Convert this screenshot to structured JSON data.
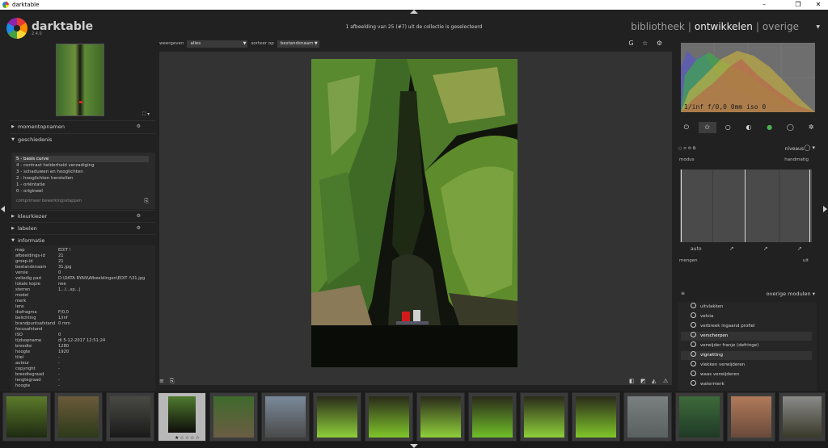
{
  "window": {
    "title": "darktable",
    "minimize": "–",
    "maximize": "❐",
    "close": "✕"
  },
  "header": {
    "logo_name": "darktable",
    "logo_version": "2.4.0",
    "collection_info": "1 afbeelding van 25 (#7) uit de collectie is geselecteerd",
    "views": [
      {
        "label": "bibliotheek"
      },
      {
        "label": "ontwikkelen"
      },
      {
        "label": "overige"
      }
    ]
  },
  "center": {
    "show_label": "weergeven",
    "show_value": "alles",
    "sort_label": "sorteer op",
    "sort_value": "bestandsnaam",
    "icons": "G ☆ ⚙"
  },
  "left": {
    "zoom": "⛶ ▾",
    "sections": {
      "snapshots": "momentopnamen",
      "history": "geschiedenis",
      "colorpicker": "kleurkiezer",
      "tags": "labelen",
      "info": "informatie"
    },
    "history": [
      "5 - basis curve",
      "4 - contrast helderheid verzadiging",
      "3 - schaduwen en hooglichten",
      "2 - hooglichten herstellen",
      "1 - oriëntatie",
      "0 - origineel"
    ],
    "compress": "comprimeer bewerkingsstappen",
    "info": [
      {
        "k": "map",
        "v": "EDIT !"
      },
      {
        "k": "afbeeldings-id",
        "v": "21"
      },
      {
        "k": "groep-id",
        "v": "21"
      },
      {
        "k": "bestandsnaam",
        "v": "31.jpg"
      },
      {
        "k": "versie",
        "v": "0"
      },
      {
        "k": "volledig pad",
        "v": "D:\\DATA RYAN\\Afbeeldingen\\EDIT !\\31.jpg"
      },
      {
        "k": "lokale kopie",
        "v": "nee"
      },
      {
        "k": "sterren",
        "v": "1...l...sp...j"
      },
      {
        "k": "model",
        "v": ""
      },
      {
        "k": "merk",
        "v": ""
      },
      {
        "k": "lens",
        "v": ""
      },
      {
        "k": "diafragma",
        "v": "F/0,0"
      },
      {
        "k": "belichting",
        "v": "1/inf"
      },
      {
        "k": "brandpuntsafstand",
        "v": "0 mm"
      },
      {
        "k": "focusafstand",
        "v": ""
      },
      {
        "k": "ISO",
        "v": "0"
      },
      {
        "k": "tijdsopname",
        "v": "di 5-12-2017 12:51:24"
      },
      {
        "k": "breedte",
        "v": "1280"
      },
      {
        "k": "hoogte",
        "v": "1920"
      },
      {
        "k": "titel",
        "v": "-"
      },
      {
        "k": "auteur",
        "v": "-"
      },
      {
        "k": "copyright",
        "v": "-"
      },
      {
        "k": "breedtegraad",
        "v": "-"
      },
      {
        "k": "lengtegraad",
        "v": "-"
      },
      {
        "k": "hoogte",
        "v": "-"
      }
    ]
  },
  "right": {
    "histogram_readout": "1/inf f/0,0 0mm iso 0",
    "levels_title": "niveaus",
    "modus_label": "modus",
    "modus_value": "handmatig",
    "auto_label": "auto",
    "blend_label": "mengen",
    "blend_value": "uit",
    "other_modules_label": "overige modulen",
    "other_modules": [
      {
        "label": "uitvlakken",
        "on": false
      },
      {
        "label": "velvia",
        "on": false
      },
      {
        "label": "verbreek ingaand profiel",
        "on": false
      },
      {
        "label": "verscherpen",
        "on": true
      },
      {
        "label": "verwijder franje (defringe)",
        "on": false
      },
      {
        "label": "vignetting",
        "on": true
      },
      {
        "label": "vlekken verwijderen",
        "on": false
      },
      {
        "label": "waas verwijderen",
        "on": false
      },
      {
        "label": "watermerk",
        "on": false
      }
    ]
  },
  "filmstrip": {
    "stars": "★☆☆☆☆",
    "thumbs": [
      {
        "c1": "#5b7a2a",
        "c2": "#1f2a12"
      },
      {
        "c1": "#6a5a3a",
        "c2": "#2d3a1a"
      },
      {
        "c1": "#4a4a44",
        "c2": "#1a1a1a"
      },
      {
        "c1": "#4f7a2e",
        "c2": "#0e0e0a"
      },
      {
        "c1": "#3f6a2c",
        "c2": "#6b5d44"
      },
      {
        "c1": "#7a8a9a",
        "c2": "#4a4a4a"
      },
      {
        "c1": "#2a2a1a",
        "c2": "#8ed03a"
      },
      {
        "c1": "#2a2a1a",
        "c2": "#7fc62a"
      },
      {
        "c1": "#2a2a1a",
        "c2": "#8ed03a"
      },
      {
        "c1": "#2a2a1a",
        "c2": "#6fbe28"
      },
      {
        "c1": "#2a2a1a",
        "c2": "#8ed03a"
      },
      {
        "c1": "#2a2a1a",
        "c2": "#7fc62a"
      },
      {
        "c1": "#7a8080",
        "c2": "#5a6060"
      },
      {
        "c1": "#3e6a3a",
        "c2": "#1f3a26"
      },
      {
        "c1": "#b07a5a",
        "c2": "#6a4a3a"
      },
      {
        "c1": "#8a8a8a",
        "c2": "#3a3a2a"
      },
      {
        "c1": "#8a6a4a",
        "c2": "#3a2a1a"
      }
    ]
  }
}
